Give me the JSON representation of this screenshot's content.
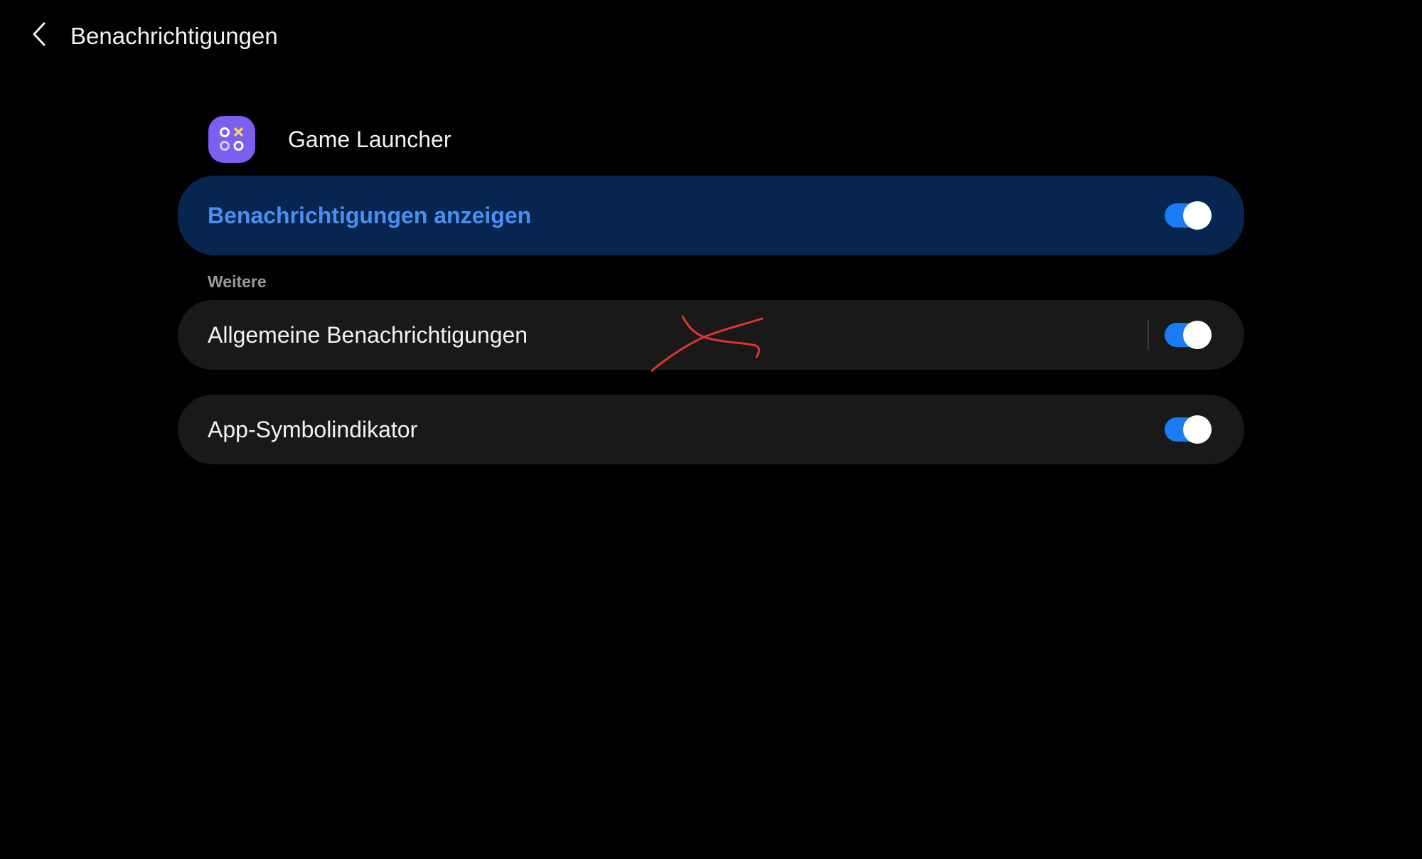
{
  "header": {
    "back_icon": "chevron-left-icon",
    "title": "Benachrichtigungen"
  },
  "app": {
    "icon": "game-launcher-icon",
    "icon_color": "#7c5ef0",
    "name": "Game Launcher"
  },
  "main_toggle": {
    "label": "Benachrichtigungen anzeigen",
    "enabled": true,
    "background": "#06264f",
    "label_color": "#4a8ef0"
  },
  "section": {
    "label": "Weitere"
  },
  "settings": [
    {
      "label": "Allgemeine Benachrichtigungen",
      "enabled": true
    },
    {
      "label": "App-Symbolindikator",
      "enabled": true
    }
  ],
  "colors": {
    "background": "#000000",
    "card": "#191919",
    "accent": "#1a7cf5",
    "annotation": "#e0342b"
  }
}
